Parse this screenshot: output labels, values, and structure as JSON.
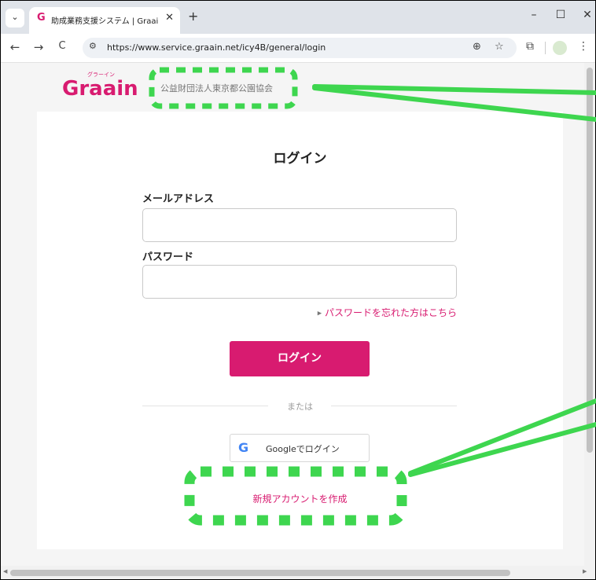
{
  "browser": {
    "tab_menu_icon": "chevron-down-icon",
    "tab": {
      "favicon": "G",
      "title": "助成業務支援システム | Graain",
      "close": "✕"
    },
    "new_tab": "+",
    "window": {
      "minimize": "–",
      "maximize": "☐",
      "close": "✕"
    },
    "nav": {
      "back": "←",
      "forward": "→",
      "reload": "C"
    },
    "url": "https://www.service.graain.net/icy4B/general/login",
    "site_info_icon": "⚙",
    "zoom_icon": "⊕",
    "bookmark_icon": "☆",
    "extensions_icon": "⧉",
    "menu_icon": "⋮"
  },
  "header": {
    "logo_text": "Graain",
    "logo_ruby": "グラーイン",
    "organization": "公益財団法人東京都公園協会"
  },
  "login": {
    "title": "ログイン",
    "email_label": "メールアドレス",
    "email_value": "",
    "password_label": "パスワード",
    "password_value": "",
    "forgot_link": "パスワードを忘れた方はこちら",
    "submit": "ログイン",
    "or": "または",
    "google_logo": "G",
    "google_button": "Googleでログイン",
    "new_account": "新規アカウントを作成"
  },
  "colors": {
    "brand": "#d81b70",
    "annotation": "#3ed64f"
  }
}
